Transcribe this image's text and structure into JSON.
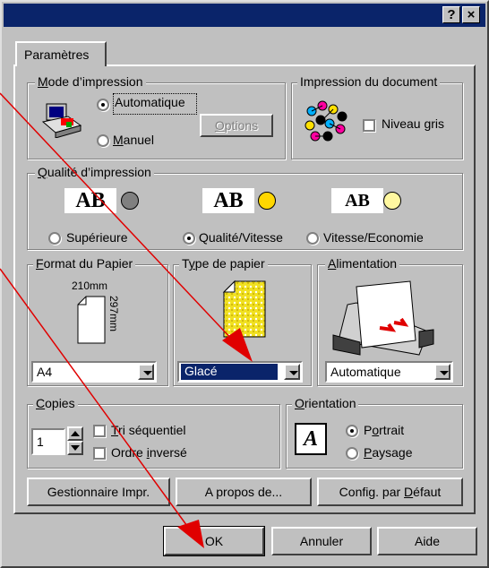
{
  "titlebar": {
    "help": "?",
    "close": "×"
  },
  "tab": {
    "label": "Paramètres"
  },
  "mode": {
    "legend": "Mode d'impression",
    "automatique": "Automatique",
    "manuel": "Manuel",
    "options": "Options",
    "selected": "automatique"
  },
  "document": {
    "legend": "Impression du document",
    "niveau_gris": "Niveau gris"
  },
  "qualite": {
    "legend": "Qualité d'impression",
    "icon_text": "AB",
    "superieure": "Supérieure",
    "qualite_vitesse": "Qualité/Vitesse",
    "vitesse_economie": "Vitesse/Economie",
    "selected": "qualite_vitesse"
  },
  "format": {
    "legend": "Format du Papier",
    "width": "210mm",
    "height": "297mm",
    "value": "A4"
  },
  "type": {
    "legend": "Type de papier",
    "value": "Glacé"
  },
  "alimentation": {
    "legend": "Alimentation",
    "value": "Automatique"
  },
  "copies": {
    "legend": "Copies",
    "value": "1",
    "tri": "Tri séquentiel",
    "ordre": "Ordre inversé"
  },
  "orientation": {
    "legend": "Orientation",
    "icon_text": "A",
    "portrait": "Portrait",
    "paysage": "Paysage",
    "selected": "portrait"
  },
  "buttons": {
    "gestionnaire": "Gestionnaire Impr.",
    "apropos": "A propos de...",
    "config": "Config. par Défaut",
    "ok": "OK",
    "annuler": "Annuler",
    "aide": "Aide"
  },
  "colors": {
    "titlebar": "#0a246a",
    "highlight": "#0a246a",
    "annotation": "#ff0000",
    "face": "#c0c0c0"
  }
}
